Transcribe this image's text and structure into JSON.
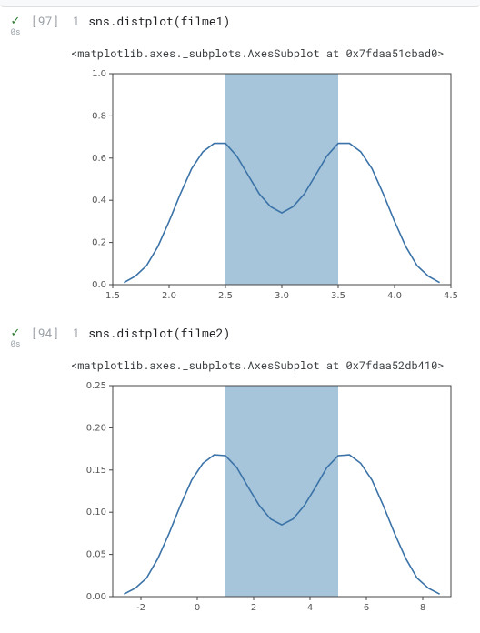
{
  "cells": [
    {
      "status_icon": "✓",
      "exec_time": "0s",
      "exec_count": "[97]",
      "line_number": "1",
      "code": "sns.distplot(filme1)",
      "repr": "<matplotlib.axes._subplots.AxesSubplot at 0x7fdaa51cbad0>"
    },
    {
      "status_icon": "✓",
      "exec_time": "0s",
      "exec_count": "[94]",
      "line_number": "1",
      "code": "sns.distplot(filme2)",
      "repr": "<matplotlib.axes._subplots.AxesSubplot at 0x7fdaa52db410>"
    }
  ],
  "chart_data": [
    {
      "type": "line",
      "title": "",
      "xlabel": "",
      "ylabel": "",
      "xlim": [
        1.5,
        4.5
      ],
      "ylim": [
        0.0,
        1.0
      ],
      "xticks": [
        1.5,
        2.0,
        2.5,
        3.0,
        3.5,
        4.0,
        4.5
      ],
      "yticks": [
        0.0,
        0.2,
        0.4,
        0.6,
        0.8,
        1.0
      ],
      "bar": {
        "x0": 2.5,
        "x1": 3.5,
        "height": 1.0
      },
      "series": [
        {
          "name": "kde",
          "x": [
            1.6,
            1.7,
            1.8,
            1.9,
            2.0,
            2.1,
            2.2,
            2.3,
            2.4,
            2.5,
            2.6,
            2.7,
            2.8,
            2.9,
            3.0,
            3.1,
            3.2,
            3.3,
            3.4,
            3.5,
            3.6,
            3.7,
            3.8,
            3.9,
            4.0,
            4.1,
            4.2,
            4.3,
            4.4
          ],
          "y": [
            0.01,
            0.04,
            0.09,
            0.18,
            0.3,
            0.43,
            0.55,
            0.63,
            0.67,
            0.67,
            0.61,
            0.52,
            0.43,
            0.37,
            0.34,
            0.37,
            0.43,
            0.52,
            0.61,
            0.67,
            0.67,
            0.63,
            0.55,
            0.43,
            0.3,
            0.18,
            0.09,
            0.04,
            0.01
          ]
        }
      ]
    },
    {
      "type": "line",
      "title": "",
      "xlabel": "",
      "ylabel": "",
      "xlim": [
        -3.0,
        9.0
      ],
      "ylim": [
        0.0,
        0.25
      ],
      "xticks": [
        -2,
        0,
        2,
        4,
        6,
        8
      ],
      "yticks": [
        0.0,
        0.05,
        0.1,
        0.15,
        0.2,
        0.25
      ],
      "bar": {
        "x0": 1.0,
        "x1": 5.0,
        "height": 0.25
      },
      "series": [
        {
          "name": "kde",
          "x": [
            -2.6,
            -2.2,
            -1.8,
            -1.4,
            -1.0,
            -0.6,
            -0.2,
            0.2,
            0.6,
            1.0,
            1.4,
            1.8,
            2.2,
            2.6,
            3.0,
            3.4,
            3.8,
            4.2,
            4.6,
            5.0,
            5.4,
            5.8,
            6.2,
            6.6,
            7.0,
            7.4,
            7.8,
            8.2,
            8.6
          ],
          "y": [
            0.003,
            0.01,
            0.022,
            0.045,
            0.075,
            0.108,
            0.138,
            0.158,
            0.168,
            0.167,
            0.153,
            0.13,
            0.108,
            0.092,
            0.085,
            0.092,
            0.108,
            0.13,
            0.153,
            0.167,
            0.168,
            0.158,
            0.138,
            0.108,
            0.075,
            0.045,
            0.022,
            0.01,
            0.003
          ]
        }
      ]
    }
  ]
}
